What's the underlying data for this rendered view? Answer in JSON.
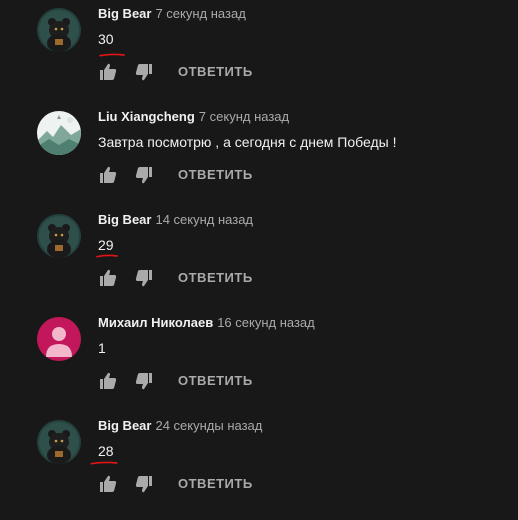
{
  "comments": [
    {
      "author": "Big Bear",
      "time": "7 секунд назад",
      "text": "30",
      "reply": "ОТВЕТИТЬ",
      "avatar": "bear-avatar"
    },
    {
      "author": "Liu Xiangcheng",
      "time": "7 секунд назад",
      "text": "Завтра посмотрю , а сегодня с днем Победы !",
      "reply": "ОТВЕТИТЬ",
      "avatar": "landscape-avatar"
    },
    {
      "author": "Big Bear",
      "time": "14 секунд назад",
      "text": "29",
      "reply": "ОТВЕТИТЬ",
      "avatar": "bear-avatar"
    },
    {
      "author": "Михаил Николаев",
      "time": "16 секунд назад",
      "text": "1",
      "reply": "ОТВЕТИТЬ",
      "avatar": "default-user-avatar"
    },
    {
      "author": "Big Bear",
      "time": "24 секунды назад",
      "text": "28",
      "reply": "ОТВЕТИТЬ",
      "avatar": "bear-avatar"
    }
  ],
  "colors": {
    "background": "#181818",
    "text": "#f1f1f1",
    "secondary": "#aaaaaa",
    "annotation": "#e01515",
    "default_avatar": "#c2185b"
  }
}
